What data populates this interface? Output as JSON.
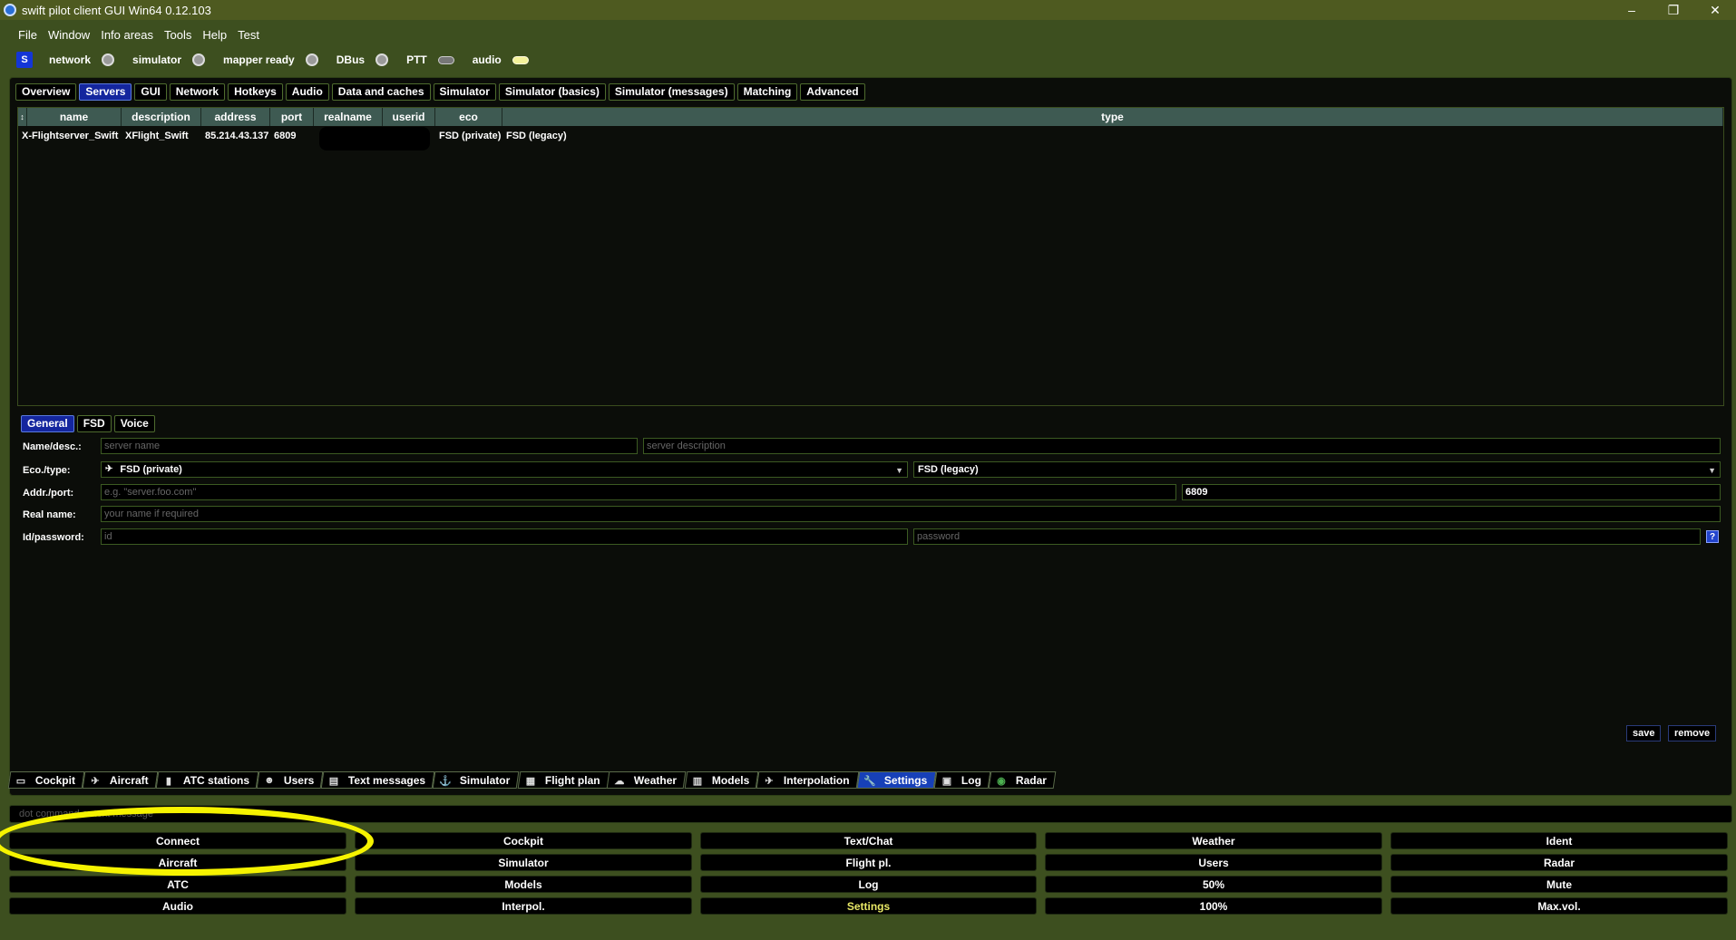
{
  "window": {
    "title": "swift pilot client GUI Win64 0.12.103",
    "controls": [
      "–",
      "❐",
      "✕"
    ]
  },
  "menu": [
    "File",
    "Window",
    "Info areas",
    "Tools",
    "Help",
    "Test"
  ],
  "status": {
    "logo": "S",
    "indicators": [
      {
        "label": "network",
        "state": "off"
      },
      {
        "label": "simulator",
        "state": "off"
      },
      {
        "label": "mapper ready",
        "state": "off"
      },
      {
        "label": "DBus",
        "state": "off"
      },
      {
        "label": "PTT",
        "state": "off"
      },
      {
        "label": "audio",
        "state": "on"
      }
    ],
    "on_color": "#f4f29a",
    "off_color": "#9a9a9a"
  },
  "settings_tabs": {
    "items": [
      "Overview",
      "Servers",
      "GUI",
      "Network",
      "Hotkeys",
      "Audio",
      "Data and caches",
      "Simulator",
      "Simulator (basics)",
      "Simulator (messages)",
      "Matching",
      "Advanced"
    ],
    "active": "Servers"
  },
  "server_table": {
    "sort_indicator": "↕",
    "columns": [
      "name",
      "description",
      "address",
      "port",
      "realname",
      "userid",
      "eco",
      "type"
    ],
    "rows": [
      {
        "name": "X-Flightserver_Swift",
        "description": "XFlight_Swift",
        "address": "85.214.43.137",
        "port": "6809",
        "realname": "",
        "userid": "",
        "eco": "FSD (private)",
        "type": "FSD (legacy)"
      }
    ]
  },
  "form_tabs": {
    "items": [
      "General",
      "FSD",
      "Voice"
    ],
    "active": "General"
  },
  "form": {
    "name_label": "Name/desc.:",
    "name_placeholder": "server name",
    "desc_placeholder": "server description",
    "ecotype_label": "Eco./type:",
    "eco_value": "FSD (private)",
    "type_value": "FSD (legacy)",
    "addr_label": "Addr./port:",
    "addr_placeholder": "e.g. \"server.foo.com\"",
    "port_value": "6809",
    "realname_label": "Real name:",
    "realname_placeholder": "your name if required",
    "idpw_label": "Id/password:",
    "id_placeholder": "id",
    "password_placeholder": "password",
    "help_label": "?",
    "save_label": "save",
    "remove_label": "remove"
  },
  "info_tabs": {
    "items": [
      {
        "label": "Cockpit",
        "icon": "cockpit-icon"
      },
      {
        "label": "Aircraft",
        "icon": "plane-icon"
      },
      {
        "label": "ATC stations",
        "icon": "tower-icon"
      },
      {
        "label": "Users",
        "icon": "users-icon"
      },
      {
        "label": "Text messages",
        "icon": "message-icon"
      },
      {
        "label": "Simulator",
        "icon": "simulator-icon"
      },
      {
        "label": "Flight plan",
        "icon": "flightplan-icon"
      },
      {
        "label": "Weather",
        "icon": "weather-icon"
      },
      {
        "label": "Models",
        "icon": "models-icon"
      },
      {
        "label": "Interpolation",
        "icon": "interpolation-icon"
      },
      {
        "label": "Settings",
        "icon": "wrench-icon"
      },
      {
        "label": "Log",
        "icon": "log-icon"
      },
      {
        "label": "Radar",
        "icon": "radar-icon"
      }
    ],
    "active": "Settings"
  },
  "command_line": {
    "placeholder": "dot command or text message"
  },
  "buttons": {
    "rows": [
      [
        "Connect",
        "Cockpit",
        "Text/Chat",
        "Weather",
        "Ident"
      ],
      [
        "Aircraft",
        "Simulator",
        "Flight pl.",
        "Users",
        "Radar"
      ],
      [
        "ATC",
        "Models",
        "Log",
        "50%",
        "Mute"
      ],
      [
        "Audio",
        "Interpol.",
        "Settings",
        "100%",
        "Max.vol."
      ]
    ],
    "highlighted": "Settings",
    "highlight_color": "#e8e866"
  }
}
